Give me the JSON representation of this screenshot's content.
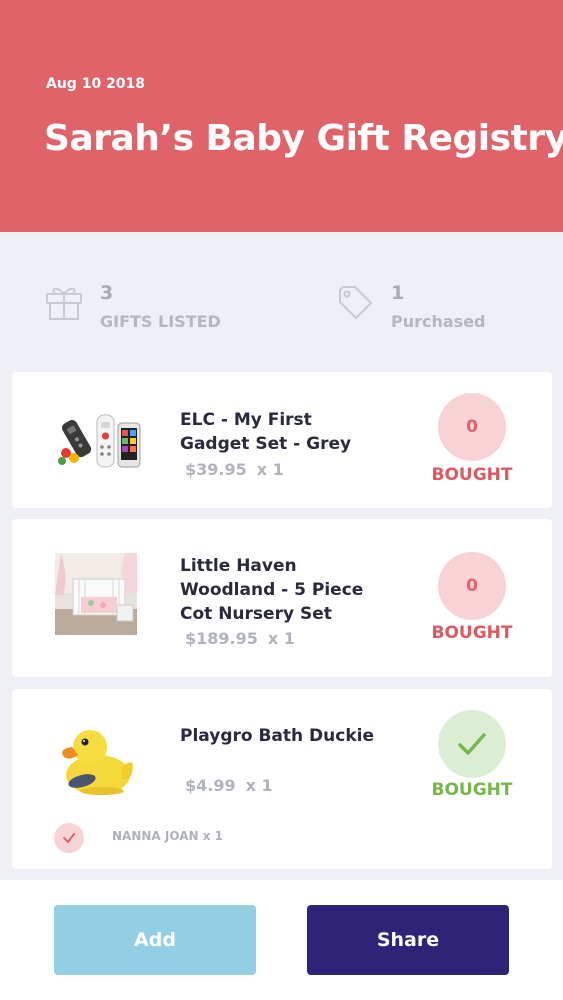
{
  "header": {
    "date": "Aug 10 2018",
    "title": "Sarah’s Baby Gift Registry"
  },
  "stats": {
    "gifts": {
      "count": "3",
      "label": "GIFTS LISTED",
      "icon": "gift-icon"
    },
    "purchased": {
      "count": "1",
      "label": "Purchased",
      "icon": "tag-icon"
    }
  },
  "items": [
    {
      "name": "ELC - My First Gadget Set - Grey",
      "price": "$39.95",
      "qty": "x 1",
      "bought_count": "0",
      "bought_label": "BOUGHT",
      "status": "pending"
    },
    {
      "name": "Little Haven Woodland - 5 Piece Cot Nursery Set",
      "price": "$189.95",
      "qty": "x 1",
      "bought_count": "0",
      "bought_label": "BOUGHT",
      "status": "pending"
    },
    {
      "name": "Playgro Bath Duckie",
      "price": "$4.99",
      "qty": "x 1",
      "bought_label": "BOUGHT",
      "status": "bought",
      "purchaser": "NANNA JOAN x 1"
    }
  ],
  "footer": {
    "add_label": "Add",
    "share_label": "Share"
  },
  "colors": {
    "header": "#e0636a",
    "bought_pending": "#dd5961",
    "bought_done": "#77b64a",
    "add_button": "#92cfe3",
    "share_button": "#2d2478"
  }
}
